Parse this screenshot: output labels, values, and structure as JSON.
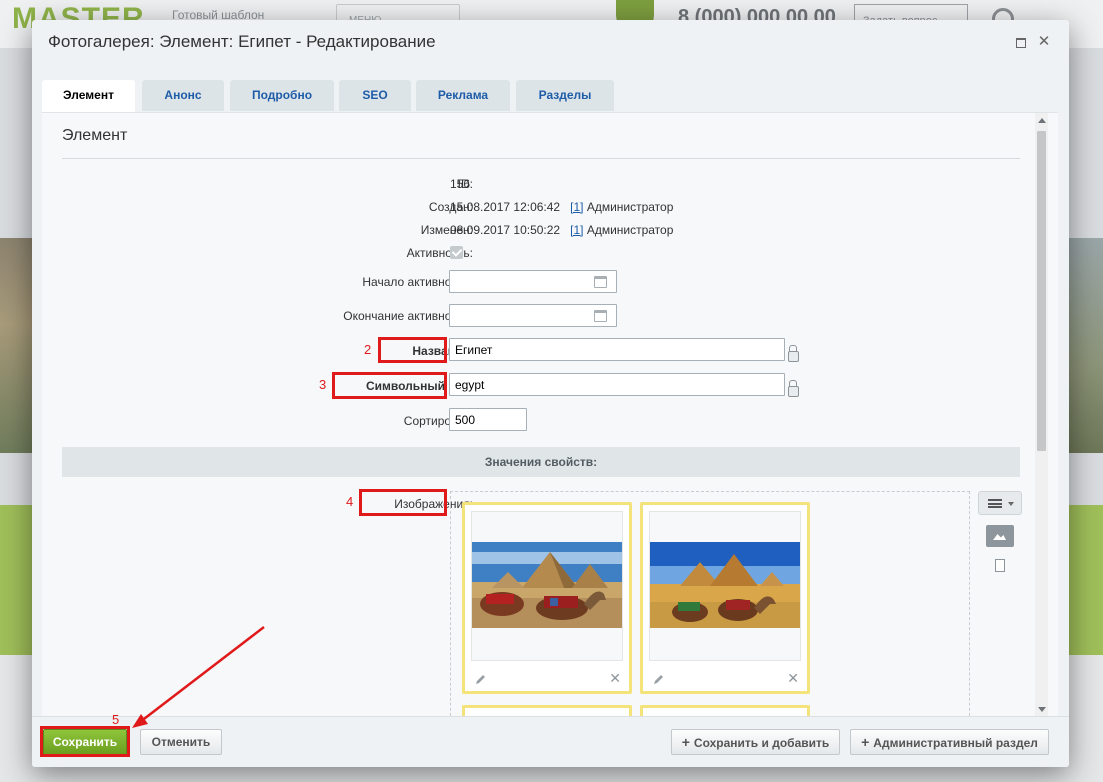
{
  "background": {
    "logo": "MASTER",
    "tagline": "Готовый шаблон",
    "menu_label": "МЕНЮ",
    "phone": "8 (000) 000 00 00",
    "ask_button": "Задать вопрос"
  },
  "dialog": {
    "title": "Фотогалерея: Элемент: Египет - Редактирование"
  },
  "tabs": [
    {
      "label": "Элемент"
    },
    {
      "label": "Анонс"
    },
    {
      "label": "Подробно"
    },
    {
      "label": "SEO"
    },
    {
      "label": "Реклама"
    },
    {
      "label": "Разделы"
    }
  ],
  "section_title": "Элемент",
  "fields": {
    "id_label": "ID:",
    "id_value": "156",
    "created_label": "Создан:",
    "created_value": "15.08.2017 12:06:42",
    "created_user_link": "[1]",
    "created_user": "Администратор",
    "modified_label": "Изменен:",
    "modified_value": "08.09.2017 10:50:22",
    "modified_user_link": "[1]",
    "modified_user": "Администратор",
    "active_label": "Активность:",
    "active_from_label": "Начало активности:",
    "active_from_value": "",
    "active_to_label": "Окончание активности:",
    "active_to_value": "",
    "name_label": "Название:",
    "name_value": "Египет",
    "code_label": "Символьный код:",
    "code_value": "egypt",
    "sort_label": "Сортировка:",
    "sort_value": "500"
  },
  "properties_header": "Значения свойств:",
  "images_label": "Изображения:",
  "annotations": [
    "1",
    "2",
    "3",
    "4",
    "5"
  ],
  "footer": {
    "save": "Сохранить",
    "cancel": "Отменить",
    "save_add": "Сохранить и добавить",
    "admin_section": "Административный раздел"
  },
  "colors": {
    "annotation_red": "#e01a1a",
    "save_green": "#6b9e1f",
    "thumb_border": "#f4e27a",
    "tab_link": "#1e5ca8"
  }
}
